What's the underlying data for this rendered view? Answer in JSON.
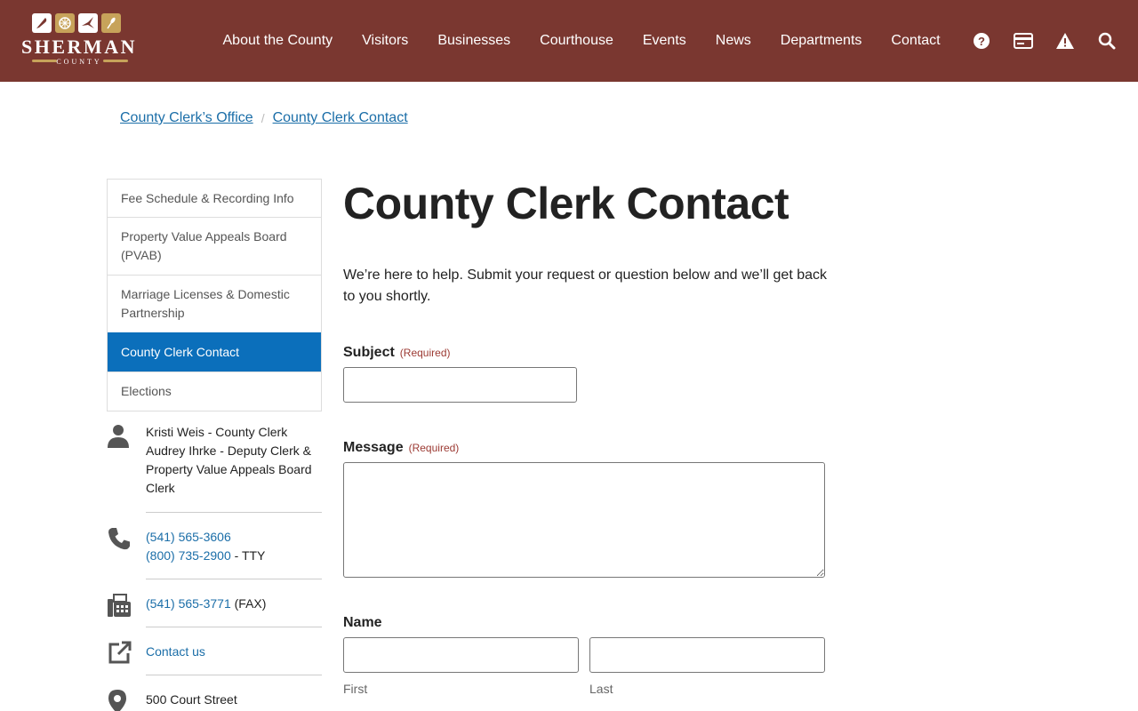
{
  "header": {
    "logo": {
      "word": "SHERMAN",
      "sub": "COUNTY",
      "icon_colors": [
        "#ffffff",
        "#c7a35a",
        "#ffffff",
        "#c7a35a"
      ]
    },
    "nav": [
      "About the County",
      "Visitors",
      "Businesses",
      "Courthouse",
      "Events",
      "News",
      "Departments",
      "Contact"
    ],
    "utility_icons": [
      "help-icon",
      "payment-card-icon",
      "alert-icon",
      "search-icon"
    ]
  },
  "breadcrumb": [
    "County Clerk’s Office",
    "County Clerk Contact"
  ],
  "sidebar": {
    "items": [
      {
        "label": "Fee Schedule & Recording Info",
        "active": false
      },
      {
        "label": "Property Value Appeals Board (PVAB)",
        "active": false
      },
      {
        "label": "Marriage Licenses & Domestic Partnership",
        "active": false
      },
      {
        "label": "County Clerk Contact",
        "active": true
      },
      {
        "label": "Elections",
        "active": false
      }
    ],
    "contact": {
      "people": [
        "Kristi Weis - County Clerk",
        "Audrey Ihrke - Deputy Clerk & Property Value Appeals Board Clerk"
      ],
      "phone": "(541) 565-3606",
      "tty_phone": "(800) 735-2900",
      "tty_suffix": " - TTY",
      "fax": "(541) 565-3771",
      "fax_suffix": " (FAX)",
      "contact_link": "Contact us",
      "address": "500 Court Street"
    }
  },
  "main": {
    "title": "County Clerk Contact",
    "intro": "We’re here to help. Submit your request or question below and we’ll get back to you shortly.",
    "required_text": "(Required)",
    "subject_label": "Subject",
    "message_label": "Message",
    "name_label": "Name",
    "first_label": "First",
    "last_label": "Last"
  },
  "colors": {
    "header_bg": "#7a3730",
    "active_nav": "#0b6fbb",
    "link": "#1b6ea8",
    "required": "#9c3a33"
  }
}
